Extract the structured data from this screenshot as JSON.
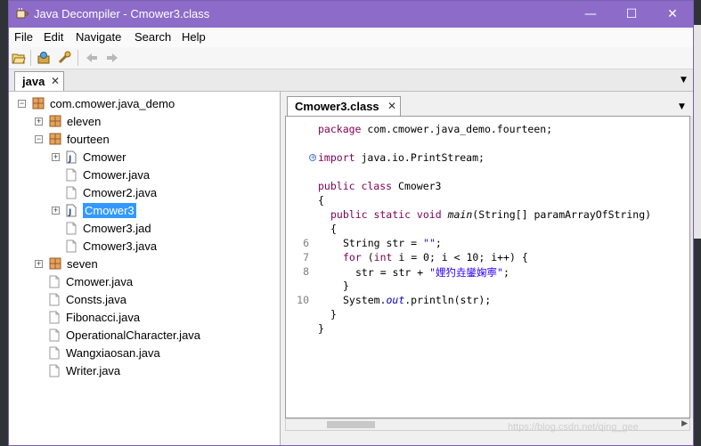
{
  "window": {
    "title": "Java Decompiler - Cmower3.class",
    "controls": [
      "—",
      "☐",
      "✕"
    ]
  },
  "menu": [
    "File",
    "Edit",
    "Navigate",
    "Search",
    "Help"
  ],
  "outer_tab": {
    "label": "java",
    "close": "✕"
  },
  "tree": {
    "root": "com.cmower.java_demo",
    "items": [
      {
        "label": "eleven"
      },
      {
        "label": "fourteen"
      },
      {
        "label": "Cmower"
      },
      {
        "label": "Cmower.java"
      },
      {
        "label": "Cmower2.java"
      },
      {
        "label": "Cmower3"
      },
      {
        "label": "Cmower3.jad"
      },
      {
        "label": "Cmower3.java"
      },
      {
        "label": "seven"
      },
      {
        "label": "Cmower.java"
      },
      {
        "label": "Consts.java"
      },
      {
        "label": "Fibonacci.java"
      },
      {
        "label": "OperationalCharacter.java"
      },
      {
        "label": "Wangxiaosan.java"
      },
      {
        "label": "Writer.java"
      }
    ]
  },
  "code_tab": {
    "label": "Cmower3.class",
    "close": "✕"
  },
  "code": {
    "l1_kw": "package",
    "l1_rest": " com.cmower.java_demo.fourteen;",
    "l2_kw": "import",
    "l2_rest": " java.io.PrintStream;",
    "l3_kw": "public class",
    "l3_rest": " Cmower3",
    "l4": "{",
    "l5_kw": "public static void",
    "l5_name": "main",
    "l5_rest": "(String[] paramArrayOfString)",
    "l6": "{",
    "l7_pre": "String str = ",
    "l7_str": "\"\"",
    "l7_end": ";",
    "l8_kw": "for",
    "l8_a": " (",
    "l8_int": "int",
    "l8_b": " i = 0; i < 10; i++) {",
    "l9_pre": "str = str + ",
    "l9_str": "\"娌犳垚鑾婅寕\"",
    "l9_end": ";",
    "l10": "}",
    "l11_pre": "System.",
    "l11_out": "out",
    "l11_rest": ".println(str);",
    "l12": "}",
    "l13": "}",
    "line_numbers": [
      "6",
      "7",
      "8",
      "10"
    ]
  },
  "watermark": "https://blog.csdn.net/qing_gee"
}
